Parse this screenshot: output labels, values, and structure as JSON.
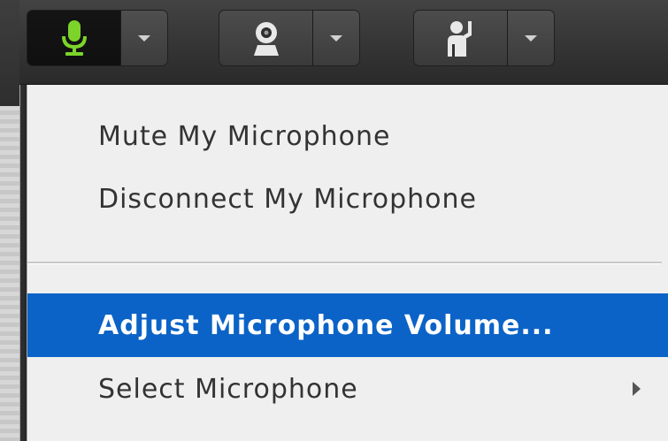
{
  "toolbar": {
    "groups": [
      {
        "name": "microphone",
        "icon": "microphone-icon",
        "state": "active",
        "accent": "#7cd42b"
      },
      {
        "name": "camera",
        "icon": "webcam-icon",
        "state": "inactive"
      },
      {
        "name": "status",
        "icon": "raise-hand-icon",
        "state": "inactive"
      }
    ]
  },
  "menu": {
    "items": [
      {
        "label": "Mute My Microphone"
      },
      {
        "label": "Disconnect My Microphone"
      },
      {
        "label": "Adjust Microphone Volume...",
        "highlighted": true
      },
      {
        "label": "Select Microphone",
        "has_submenu": true
      }
    ]
  },
  "colors": {
    "toolbar_bg": "#363636",
    "menu_bg": "#efefef",
    "highlight": "#0b63c7"
  }
}
